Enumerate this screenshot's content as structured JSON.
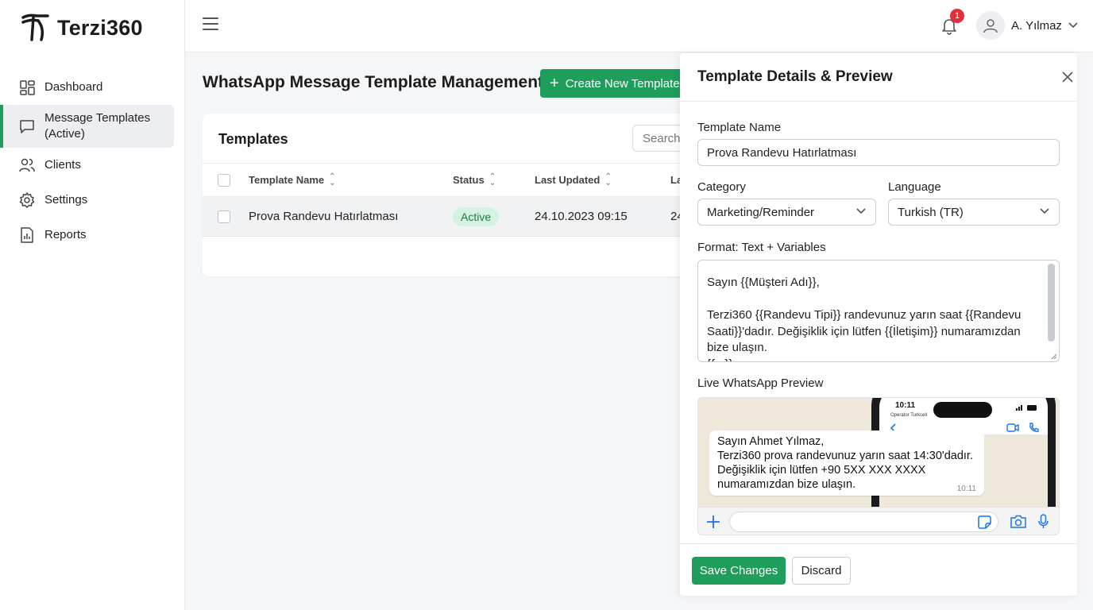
{
  "brand": {
    "name": "Terzi360"
  },
  "sidebar": {
    "items": [
      {
        "label": "Dashboard"
      },
      {
        "label": "Message Templates (Active)"
      },
      {
        "label": "Clients"
      },
      {
        "label": "Settings"
      },
      {
        "label": "Reports"
      }
    ]
  },
  "topbar": {
    "notification_count": "1",
    "user_name": "A. Yılmaz"
  },
  "main": {
    "title": "WhatsApp Message Template Management",
    "create_button": "Create New Template",
    "card_title": "Templates",
    "search_placeholder": "Search",
    "columns": [
      "Template Name",
      "Status",
      "Last Updated",
      "La"
    ],
    "rows": [
      {
        "name": "Prova Randevu Hatırlatması",
        "status": "Active",
        "updated": "24.10.2023 09:15",
        "extra": "24"
      }
    ]
  },
  "panel": {
    "title": "Template Details & Preview",
    "template_name_label": "Template Name",
    "template_name_value": "Prova Randevu Hatırlatması",
    "category_label": "Category",
    "category_value": "Marketing/Reminder",
    "language_label": "Language",
    "language_value": "Turkish (TR)",
    "format_label": "Format: Text + Variables",
    "body_text": "Sayın {{Müşteri Adı}},\n\nTerzi360 {{Randevu Tipi}} randevunuz yarın saat {{Randevu Saati}}'dadır. Değişiklik için lütfen {{İletişim}} numaramızdan bize ulaşın.\n{{...}}",
    "preview_label": "Live WhatsApp Preview",
    "preview": {
      "time": "10:11",
      "operator": "Operator Turkcell",
      "message": "Sayın Ahmet Yılmaz,\nTerzi360 prova randevunuz yarın saat 14:30'dadır.\nDeğişiklik için lütfen +90 5XX XXX XXXX\nnumaramızdan bize ulaşın.",
      "message_time": "10:11"
    },
    "save_button": "Save Changes",
    "discard_button": "Discard"
  },
  "colors": {
    "accent": "#1e9e5a",
    "badge": "#e0303a",
    "status_bg": "#d6f2e0",
    "status_text": "#1b7a44"
  }
}
